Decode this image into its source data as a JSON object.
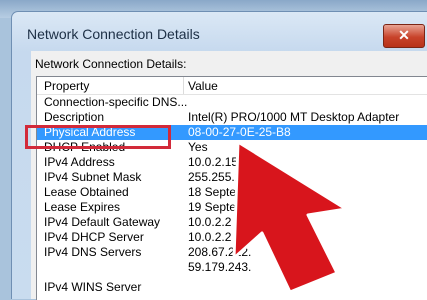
{
  "background": {
    "text": ""
  },
  "window": {
    "title": "Network Connection Details",
    "close_glyph": "✕"
  },
  "dialog": {
    "heading": "Network Connection Details:",
    "columns": {
      "property": "Property",
      "value": "Value"
    },
    "rows": [
      {
        "property": "Connection-specific DNS...",
        "value": ""
      },
      {
        "property": "Description",
        "value": "Intel(R) PRO/1000 MT Desktop Adapter"
      },
      {
        "property": "Physical Address",
        "value": "08-00-27-0E-25-B8",
        "selected": true
      },
      {
        "property": "DHCP Enabled",
        "value": "Yes"
      },
      {
        "property": "IPv4 Address",
        "value": "10.0.2.15"
      },
      {
        "property": "IPv4 Subnet Mask",
        "value": "255.255.255"
      },
      {
        "property": "Lease Obtained",
        "value": "18 Septemb                    7:26"
      },
      {
        "property": "Lease Expires",
        "value": "19 Septemb"
      },
      {
        "property": "IPv4 Default Gateway",
        "value": "10.0.2.2"
      },
      {
        "property": "IPv4 DHCP Server",
        "value": "10.0.2.2"
      },
      {
        "property": "IPv4 DNS Servers",
        "value": "208.67.222."
      },
      {
        "property": "",
        "value": "59.179.243."
      },
      {
        "property": "IPv4 WINS Server",
        "value": ""
      }
    ]
  },
  "colors": {
    "selection": "#3399ff",
    "highlight_box": "#d22a3a",
    "arrow": "#d8151c"
  }
}
